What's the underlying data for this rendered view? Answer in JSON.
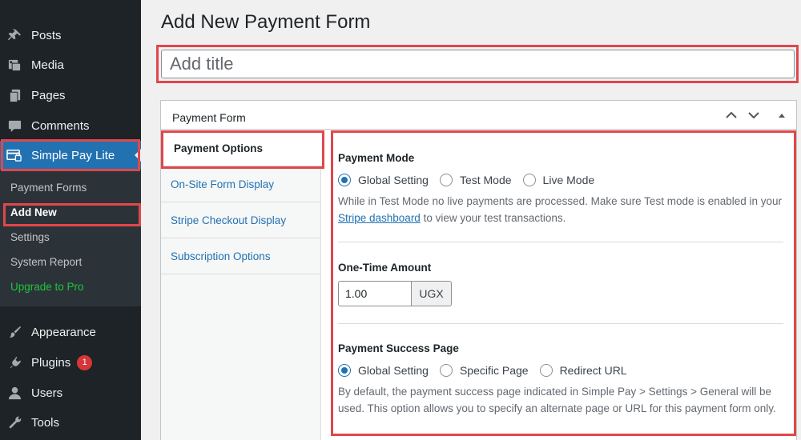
{
  "sidebar": {
    "top_items": [
      {
        "label": "Posts",
        "icon": "pushpin-icon"
      },
      {
        "label": "Media",
        "icon": "media-icon"
      },
      {
        "label": "Pages",
        "icon": "pages-icon"
      },
      {
        "label": "Comments",
        "icon": "comment-icon"
      }
    ],
    "active_item": {
      "label": "Simple Pay Lite",
      "icon": "simple-pay-icon"
    },
    "submenu": [
      {
        "label": "Payment Forms"
      },
      {
        "label": "Add New"
      },
      {
        "label": "Settings"
      },
      {
        "label": "System Report"
      },
      {
        "label": "Upgrade to Pro"
      }
    ],
    "bottom_items": [
      {
        "label": "Appearance",
        "icon": "paintbrush-icon"
      },
      {
        "label": "Plugins",
        "icon": "plugin-icon",
        "badge": "1"
      },
      {
        "label": "Users",
        "icon": "user-icon"
      },
      {
        "label": "Tools",
        "icon": "wrench-icon"
      }
    ]
  },
  "page": {
    "title": "Add New Payment Form",
    "title_placeholder": "Add title"
  },
  "panel": {
    "title": "Payment Form",
    "tabs": [
      {
        "label": "Payment Options"
      },
      {
        "label": "On-Site Form Display"
      },
      {
        "label": "Stripe Checkout Display"
      },
      {
        "label": "Subscription Options"
      }
    ],
    "payment_mode": {
      "label": "Payment Mode",
      "options": [
        "Global Setting",
        "Test Mode",
        "Live Mode"
      ],
      "selected": "Global Setting",
      "desc_before": "While in Test Mode no live payments are processed. Make sure Test mode is enabled in your ",
      "desc_link": "Stripe dashboard",
      "desc_after": " to view your test transactions."
    },
    "one_time_amount": {
      "label": "One-Time Amount",
      "value": "1.00",
      "currency": "UGX"
    },
    "success_page": {
      "label": "Payment Success Page",
      "options": [
        "Global Setting",
        "Specific Page",
        "Redirect URL"
      ],
      "selected": "Global Setting",
      "desc": "By default, the payment success page indicated in Simple Pay > Settings > General will be used. This option allows you to specify an alternate page or URL for this payment form only."
    }
  },
  "colors": {
    "sidebar_bg": "#1d2327",
    "accent": "#2271b1",
    "highlight_border": "#e0474b",
    "upgrade": "#1dc73e",
    "badge": "#d63638"
  }
}
